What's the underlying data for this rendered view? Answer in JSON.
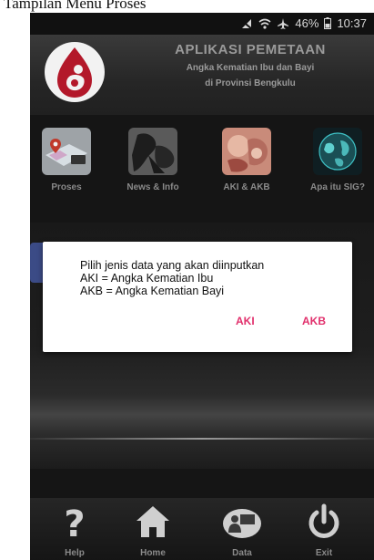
{
  "caption": "Tampilan Menu Proses",
  "status": {
    "battery": "46%",
    "time": "10:37"
  },
  "header": {
    "title": "APLIKASI PEMETAAN",
    "subtitle1": "Angka Kematian Ibu dan Bayi",
    "subtitle2": "di Provinsi Bengkulu"
  },
  "menu": [
    {
      "label": "Proses"
    },
    {
      "label": "News & Info"
    },
    {
      "label": "AKI & AKB"
    },
    {
      "label": "Apa itu SIG?"
    }
  ],
  "dialog": {
    "message_line1": "Pilih jenis data yang akan diinputkan",
    "message_line2": "AKI = Angka Kematian Ibu",
    "message_line3": "AKB = Angka Kematian Bayi",
    "button_aki": "AKI",
    "button_akb": "AKB"
  },
  "nav": [
    {
      "label": "Help"
    },
    {
      "label": "Home"
    },
    {
      "label": "Data"
    },
    {
      "label": "Exit"
    }
  ]
}
